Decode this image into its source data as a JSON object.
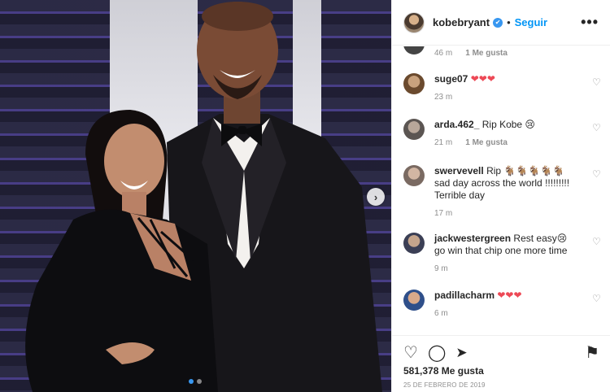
{
  "header": {
    "username": "kobebryant",
    "follow_label": "Seguir",
    "separator": "•",
    "more_label": "•••",
    "verified_mark": "✔"
  },
  "partial_comment": {
    "time": "46 m",
    "likes": "1 Me gusta"
  },
  "comments": [
    {
      "user": "suge07",
      "text": "❤❤❤",
      "time": "23 m",
      "likes": ""
    },
    {
      "user": "arda.462_",
      "text": "Rip Kobe 😢",
      "time": "21 m",
      "likes": "1 Me gusta"
    },
    {
      "user": "swervevell",
      "text": "Rip 🐐🐐🐐🐐🐐 sad day across the world !!!!!!!!! Terrible day",
      "time": "17 m",
      "likes": ""
    },
    {
      "user": "jackwestergreen",
      "text": "Rest easy😢 go win that chip one more time",
      "time": "9 m",
      "likes": ""
    },
    {
      "user": "padillacharm",
      "text": "❤❤❤",
      "time": "6 m",
      "likes": ""
    }
  ],
  "footer": {
    "like_icon": "♡",
    "comment_icon": "◯",
    "share_icon": "➤",
    "save_icon": "⚑",
    "likes_count": "581,378",
    "likes_suffix": "Me gusta",
    "date": "25 DE FEBRERO DE 2019"
  },
  "photo": {
    "next_arrow": "›",
    "carousel_total": 2,
    "carousel_active": 1
  },
  "colors": {
    "accent": "#0095f6",
    "muted": "#8e8e8e",
    "heart": "#ed4956"
  }
}
